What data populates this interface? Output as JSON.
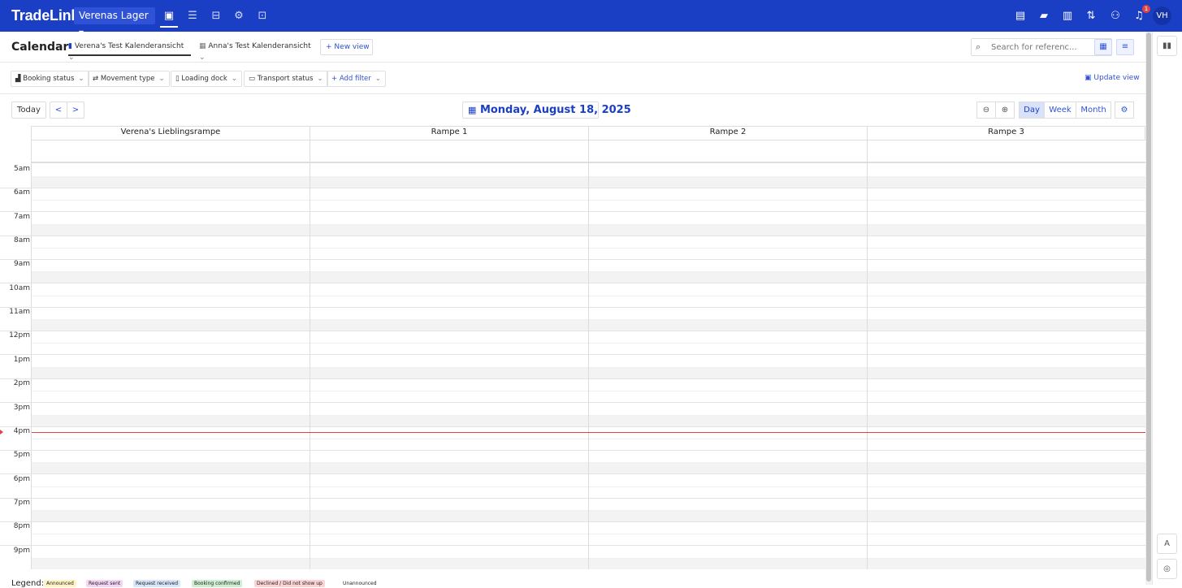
{
  "topbar": {
    "logo": "TradeLink",
    "warehouse": "Verenas Lager",
    "nav_icons": [
      "calendar-check-icon",
      "list-icon",
      "inbox-icon",
      "gear-icon",
      "contact-icon"
    ],
    "right_icons": [
      "dashboard-icon",
      "package-icon",
      "analytics-icon",
      "routing-icon",
      "users-icon",
      "bell-icon"
    ],
    "notification_count": "1",
    "avatar": "VH"
  },
  "header": {
    "title": "Calendar",
    "views": [
      "Verena's Test Kalenderansicht",
      "Anna's Test Kalenderansicht"
    ],
    "new_view": "New view",
    "search_placeholder": "Search for referenc..."
  },
  "filters": {
    "items": [
      "Booking status",
      "Movement type",
      "Loading dock",
      "Transport status",
      "Add filter"
    ],
    "update_view": "Update view"
  },
  "toolbar": {
    "today": "Today",
    "prev": "<",
    "next": ">",
    "date": "Monday, August 18, 2025",
    "modes": [
      "Day",
      "Week",
      "Month"
    ],
    "active_mode": "Day"
  },
  "calendar": {
    "resources": [
      "Verena's Lieblingsrampe",
      "Rampe 1",
      "Rampe 2",
      "Rampe 3"
    ],
    "hours": [
      "5am",
      "6am",
      "7am",
      "8am",
      "9am",
      "10am",
      "11am",
      "12pm",
      "1pm",
      "2pm",
      "3pm",
      "4pm",
      "5pm",
      "6pm",
      "7pm",
      "8pm",
      "9pm"
    ]
  },
  "legend": {
    "title": "Legend:",
    "items": [
      {
        "label": "Announced",
        "color": "#fff3c4"
      },
      {
        "label": "Request sent",
        "color": "#f3d6f5"
      },
      {
        "label": "Request received",
        "color": "#d6e6fb"
      },
      {
        "label": "Booking confirmed",
        "color": "#cdeed0"
      },
      {
        "label": "Declined / Did not show up",
        "color": "#fbd3d3"
      },
      {
        "label": "Unannounced",
        "color": "#ffffff"
      }
    ]
  },
  "colors": {
    "brand": "#1b3fc4",
    "now_line": "#e04545"
  }
}
